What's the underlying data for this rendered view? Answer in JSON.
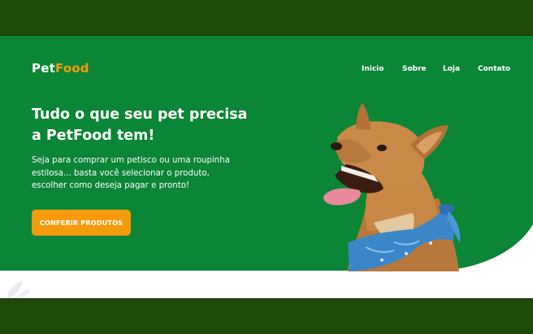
{
  "brand": {
    "logo_part1": "Pet",
    "logo_part2": "Food",
    "accent_color": "#f59a0b",
    "hero_color": "#0b8536"
  },
  "nav": {
    "items": [
      {
        "label": "Inicio"
      },
      {
        "label": "Sobre"
      },
      {
        "label": "Loja"
      },
      {
        "label": "Contato"
      }
    ]
  },
  "hero": {
    "headline_line1": "Tudo o que seu pet precisa",
    "headline_line2": "a PetFood tem!",
    "subtext_line1": "Seja para comprar um petisco ou uma roupinha",
    "subtext_line2": "estilosa... basta você selecionar o produto,",
    "subtext_line3": "escolher como deseja pagar e pronto!",
    "cta_label": "CONFERIR PRODUTOS"
  },
  "icons": {
    "dog_image": "dog-with-blue-bandana",
    "decor": "leaf-icon"
  }
}
